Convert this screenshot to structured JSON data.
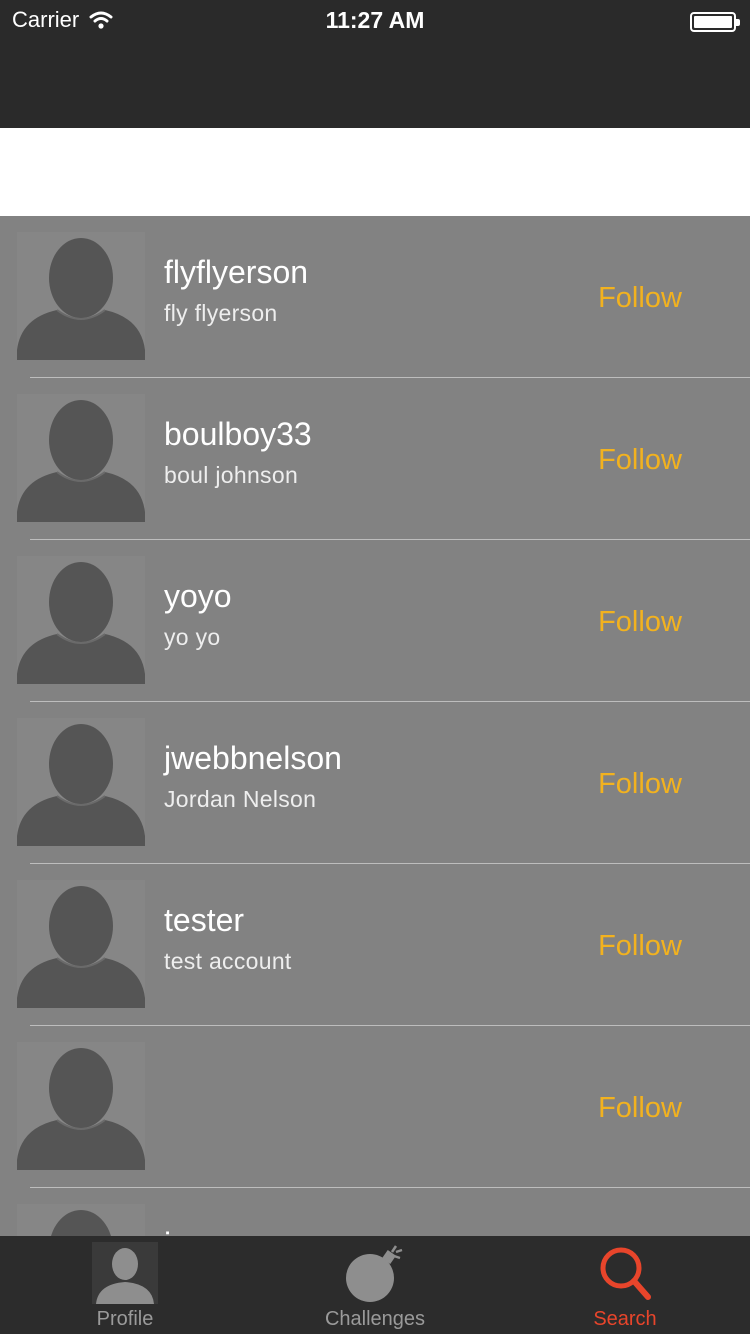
{
  "status_bar": {
    "carrier": "Carrier",
    "time": "11:27 AM"
  },
  "search": {
    "placeholder": "",
    "value": ""
  },
  "users": [
    {
      "username": "flyflyerson",
      "full_name": "fly flyerson",
      "follow_label": "Follow"
    },
    {
      "username": "boulboy33",
      "full_name": "boul johnson",
      "follow_label": "Follow"
    },
    {
      "username": "yoyo",
      "full_name": "yo yo",
      "follow_label": "Follow"
    },
    {
      "username": "jwebbnelson",
      "full_name": "Jordan Nelson",
      "follow_label": "Follow"
    },
    {
      "username": "tester",
      "full_name": "test account",
      "follow_label": "Follow"
    },
    {
      "username": "",
      "full_name": "",
      "follow_label": "Follow"
    },
    {
      "username": "i",
      "full_name": "",
      "follow_label": ""
    }
  ],
  "tabs": [
    {
      "label": "Profile",
      "icon": "profile-icon"
    },
    {
      "label": "Challenges",
      "icon": "bomb-icon"
    },
    {
      "label": "Search",
      "icon": "search-icon",
      "active": true
    }
  ],
  "colors": {
    "follow": "#f2b21f",
    "active_tab": "#e8452b",
    "bar": "#2a2a2a"
  }
}
